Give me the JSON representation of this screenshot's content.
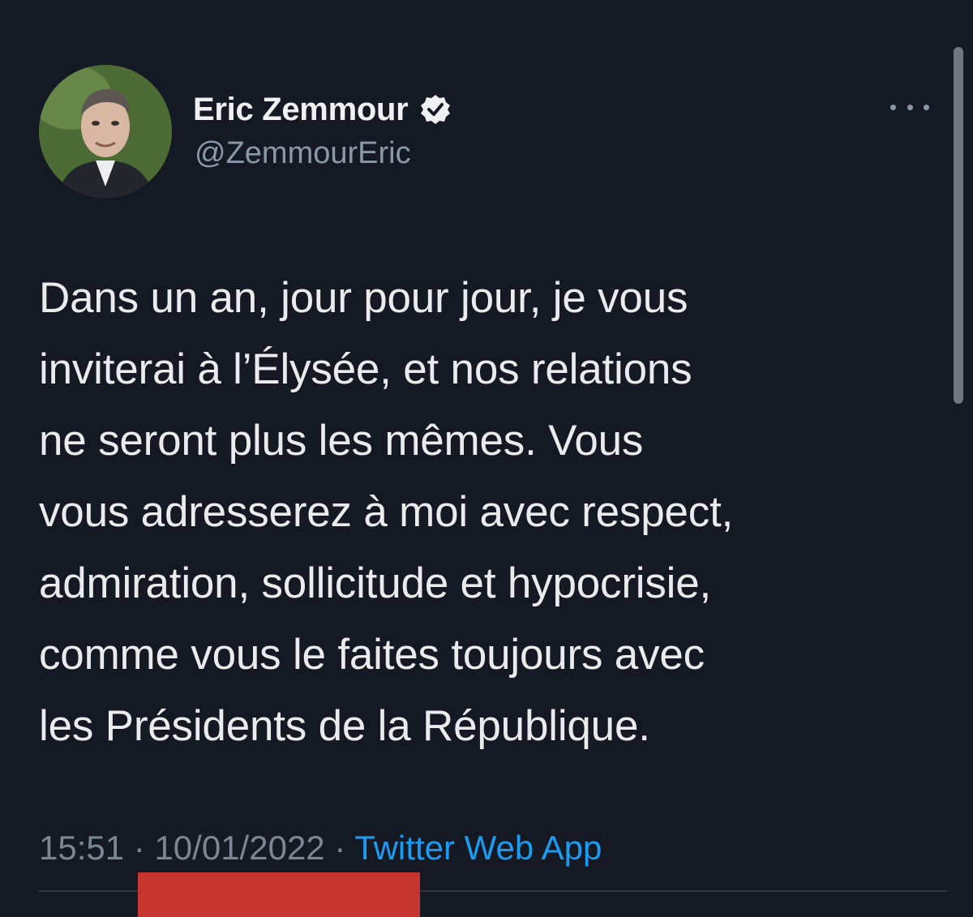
{
  "author": {
    "display_name": "Eric Zemmour",
    "handle": "@ZemmourEric",
    "verified": true,
    "avatar_icon": "profile-photo"
  },
  "tweet": {
    "text": "Dans un an, jour pour jour, je vous\ninviterai à l’Élysée, et nos relations\nne seront plus les mêmes. Vous\nvous adresserez à moi avec respect,\nadmiration, sollicitude et hypocrisie,\ncomme vous le faites toujours avec\nles Présidents de la République.",
    "time": "15:51",
    "separator": "·",
    "date": "10/01/2022",
    "source": "Twitter Web App"
  },
  "icons": {
    "more": "more-horizontal-icon",
    "verified": "verified-badge-icon"
  },
  "colors": {
    "background": "#141924",
    "accent": "#1d9bf0",
    "secondary_text": "#8b98a5",
    "redaction": "#c8352e"
  }
}
